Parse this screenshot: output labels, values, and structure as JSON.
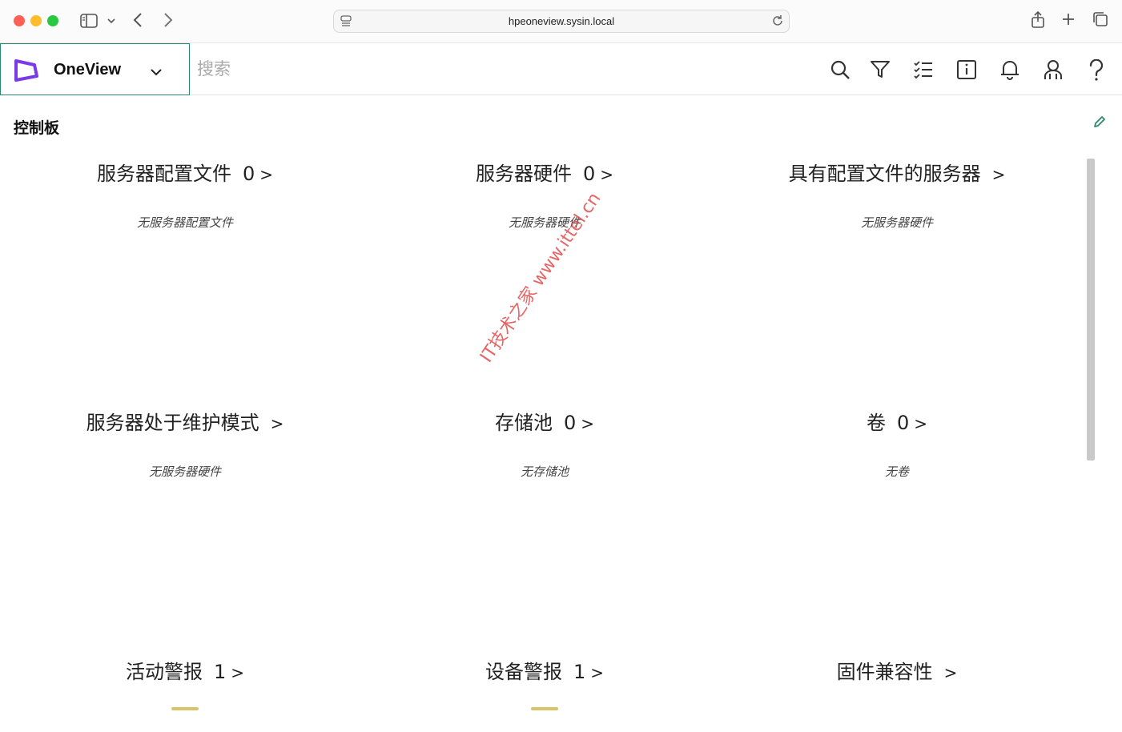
{
  "browser": {
    "url": "hpeoneview.sysin.local"
  },
  "app": {
    "brand_name": "OneView",
    "brand_color": "#7a3ae8",
    "accent_color": "#2a8a6e",
    "search_placeholder": "搜索",
    "header_icons": [
      "search-icon",
      "filter-icon",
      "activity-list-icon",
      "info-icon",
      "bell-icon",
      "user-icon",
      "help-icon"
    ]
  },
  "dashboard": {
    "title": "控制板",
    "panels": [
      {
        "title": "服务器配置文件",
        "count": "0",
        "chevron": ">",
        "empty": "无服务器配置文件"
      },
      {
        "title": "服务器硬件",
        "count": "0",
        "chevron": ">",
        "empty": "无服务器硬件"
      },
      {
        "title": "具有配置文件的服务器",
        "count": "",
        "chevron": ">",
        "empty": "无服务器硬件"
      },
      {
        "title": "服务器处于维护模式",
        "count": "",
        "chevron": ">",
        "empty": "无服务器硬件"
      },
      {
        "title": "存储池",
        "count": "0",
        "chevron": ">",
        "empty": "无存储池"
      },
      {
        "title": "卷",
        "count": "0",
        "chevron": ">",
        "empty": "无卷"
      },
      {
        "title": "活动警报",
        "count": "1",
        "chevron": ">",
        "empty": ""
      },
      {
        "title": "设备警报",
        "count": "1",
        "chevron": ">",
        "empty": ""
      },
      {
        "title": "固件兼容性",
        "count": "",
        "chevron": ">",
        "empty": ""
      }
    ]
  },
  "watermark": "IT技术之家 www.ittel.cn"
}
